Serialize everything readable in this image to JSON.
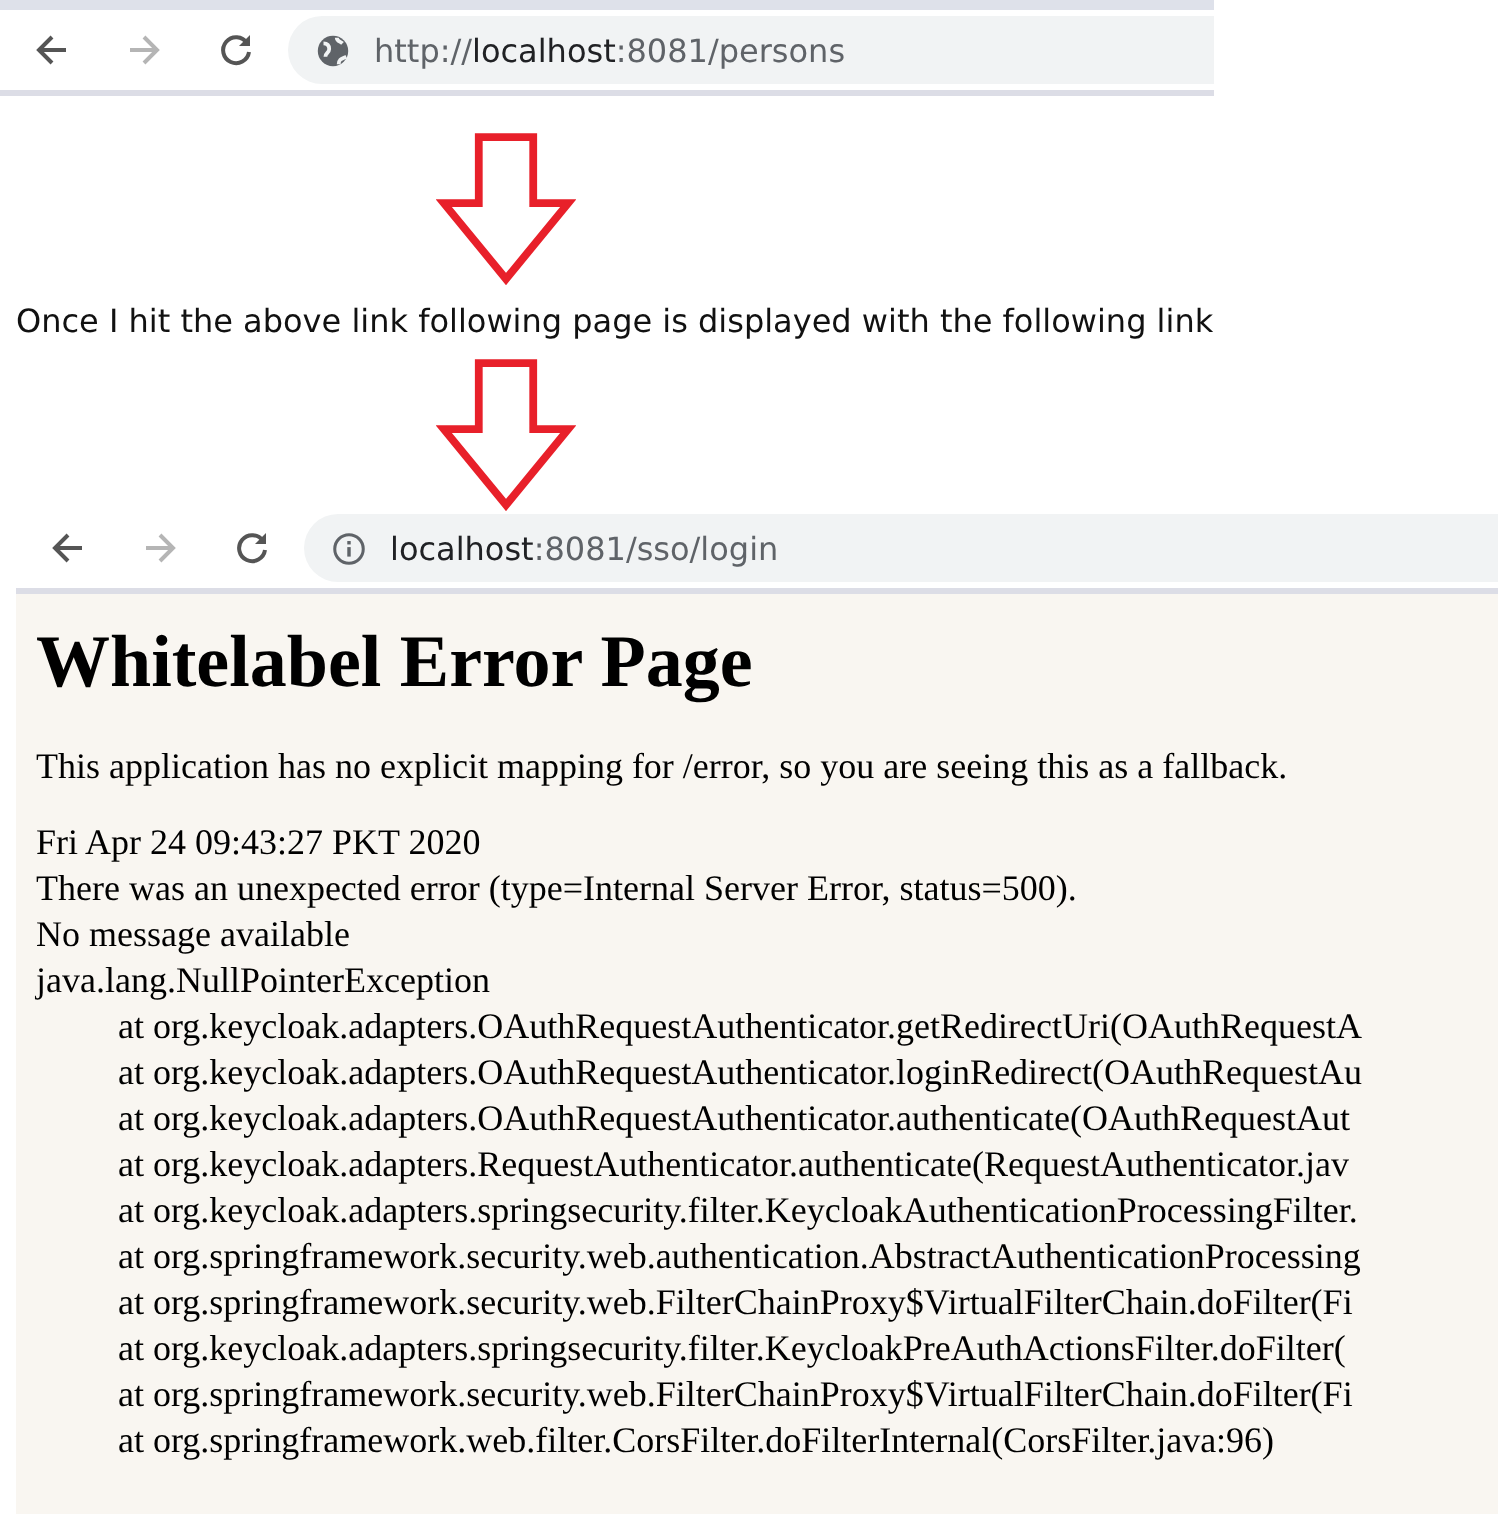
{
  "first_browser": {
    "url_scheme": "http://",
    "url_host": "localhost",
    "url_rest": ":8081/persons",
    "kind": "globe"
  },
  "caption": "Once I hit the above link following page is displayed with the following link",
  "second_browser": {
    "url_host": "localhost",
    "url_rest": ":8081/sso/login",
    "kind": "info"
  },
  "error_page": {
    "heading": "Whitelabel Error Page",
    "message": "This application has no explicit mapping for /error, so you are seeing this as a fallback.",
    "lines": [
      "Fri Apr 24 09:43:27 PKT 2020",
      "There was an unexpected error (type=Internal Server Error, status=500).",
      "No message available",
      "java.lang.NullPointerException"
    ],
    "stack": [
      "at org.keycloak.adapters.OAuthRequestAuthenticator.getRedirectUri(OAuthRequestA",
      "at org.keycloak.adapters.OAuthRequestAuthenticator.loginRedirect(OAuthRequestAu",
      "at org.keycloak.adapters.OAuthRequestAuthenticator.authenticate(OAuthRequestAut",
      "at org.keycloak.adapters.RequestAuthenticator.authenticate(RequestAuthenticator.jav",
      "at org.keycloak.adapters.springsecurity.filter.KeycloakAuthenticationProcessingFilter.",
      "at org.springframework.security.web.authentication.AbstractAuthenticationProcessing",
      "at org.springframework.security.web.FilterChainProxy$VirtualFilterChain.doFilter(Fi",
      "at org.keycloak.adapters.springsecurity.filter.KeycloakPreAuthActionsFilter.doFilter(",
      "at org.springframework.security.web.FilterChainProxy$VirtualFilterChain.doFilter(Fi",
      "at org.springframework.web.filter.CorsFilter.doFilterInternal(CorsFilter.java:96)"
    ]
  }
}
